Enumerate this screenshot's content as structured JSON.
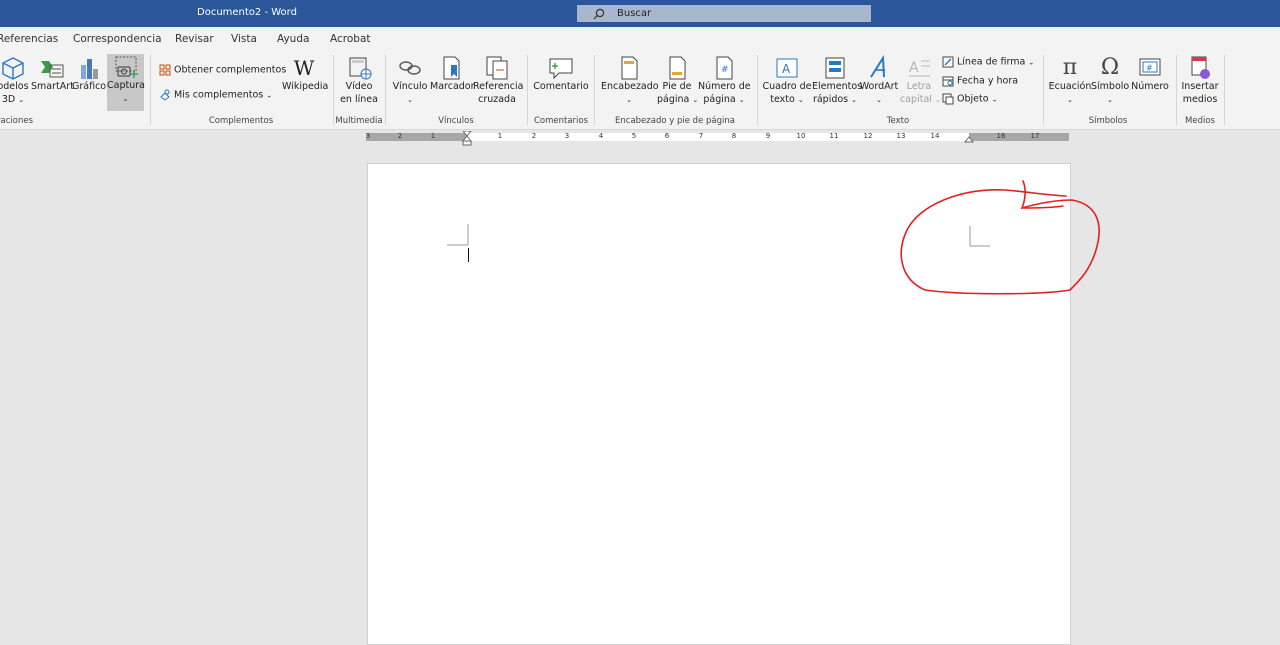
{
  "window": {
    "title": "Documento2  -  Word"
  },
  "search": {
    "placeholder": "Buscar"
  },
  "tabs": [
    "Referencias",
    "Correspondencia",
    "Revisar",
    "Vista",
    "Ayuda",
    "Acrobat"
  ],
  "ribbon": {
    "groups": {
      "ilustraciones": "raciones",
      "complementos": "Complementos",
      "multimedia": "Multimedia",
      "vinculos": "Vínculos",
      "comentarios": "Comentarios",
      "encabezado": "Encabezado y pie de página",
      "texto": "Texto",
      "simbolos": "Símbolos",
      "medios": "Medios"
    },
    "buttons": {
      "modelos3d": [
        "odelos",
        "3D"
      ],
      "smartart": "SmartArt",
      "grafico": "Gráfico",
      "captura": "Captura",
      "obtener": "Obtener complementos",
      "mis": "Mis complementos",
      "wikipedia": "Wikipedia",
      "video": [
        "Vídeo",
        "en línea"
      ],
      "vinculo": "Vínculo",
      "marcador": "Marcador",
      "referencia": [
        "Referencia",
        "cruzada"
      ],
      "comentario": "Comentario",
      "encabezado": "Encabezado",
      "pie": [
        "Pie de",
        "página"
      ],
      "numero_pagina": [
        "Número de",
        "página"
      ],
      "cuadro": [
        "Cuadro de",
        "texto"
      ],
      "elementos": [
        "Elementos",
        "rápidos"
      ],
      "wordart": "WordArt",
      "letra": [
        "Letra",
        "capital"
      ],
      "linea_firma": "Línea de firma",
      "fecha_hora": "Fecha y hora",
      "objeto": "Objeto",
      "ecuacion": "Ecuación",
      "simbolo": "Símbolo",
      "numero": "Número",
      "insertar": [
        "Insertar",
        "medios"
      ]
    }
  },
  "ruler": {
    "labels": [
      "3",
      "2",
      "1",
      "1",
      "2",
      "3",
      "4",
      "5",
      "6",
      "7",
      "8",
      "9",
      "10",
      "11",
      "12",
      "13",
      "14",
      "16",
      "17"
    ]
  },
  "colors": {
    "accent": "#2b579a",
    "annotation": "#e02020"
  }
}
